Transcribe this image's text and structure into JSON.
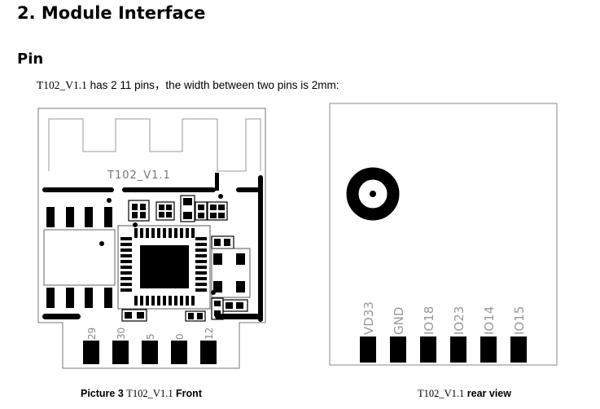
{
  "section": {
    "number": "2.",
    "title": "Module Interface"
  },
  "subsection": {
    "title": "Pin"
  },
  "intro": {
    "model": "T102_V1.1",
    "text": " has 2 11 pins，the width between two pins is 2mm:"
  },
  "front": {
    "silk_label": "T102_V1.1",
    "pin_labels": [
      "29",
      "30",
      "5",
      "0",
      "12"
    ]
  },
  "rear": {
    "pin_labels": [
      "VD33",
      "GND",
      "IO18",
      "IO23",
      "IO14",
      "IO15"
    ]
  },
  "captions": {
    "front_prefix": "Picture 3 ",
    "front_model": "T102_V1.1",
    "front_suffix": " Front",
    "rear_model": "T102_V1.1",
    "rear_suffix": " rear view"
  }
}
